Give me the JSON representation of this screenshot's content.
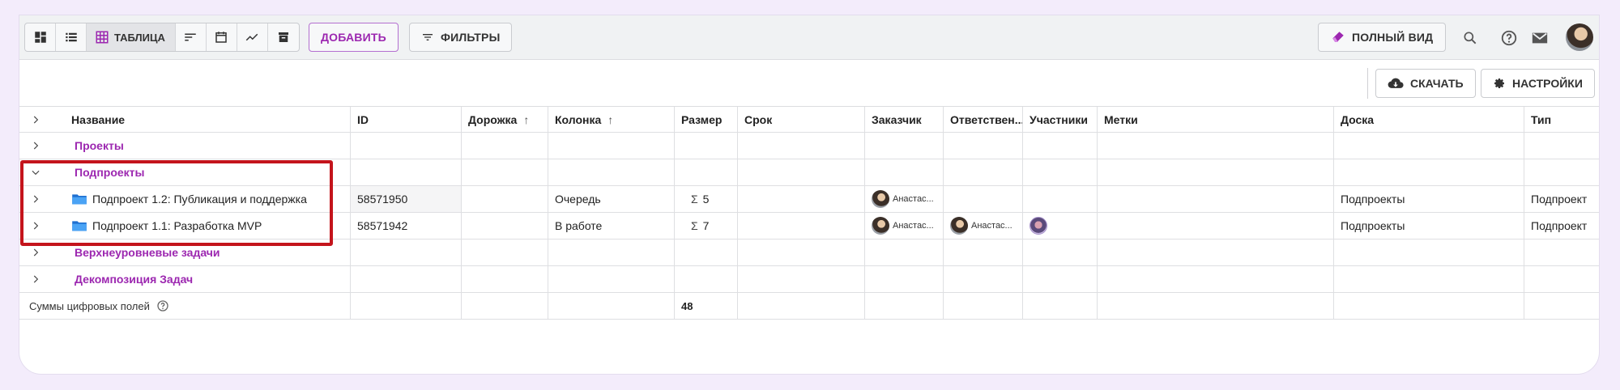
{
  "toolbar": {
    "views": [
      {
        "icon": "dashboard-icon"
      },
      {
        "icon": "list-icon"
      },
      {
        "icon": "grid-table-icon",
        "label": "ТАБЛИЦА",
        "active": true
      },
      {
        "icon": "sort-lines-icon"
      },
      {
        "icon": "calendar-icon"
      },
      {
        "icon": "trend-chart-icon"
      },
      {
        "icon": "archive-icon"
      }
    ],
    "add_label": "ДОБАВИТЬ",
    "filters_label": "ФИЛЬТРЫ",
    "full_view_label": "ПОЛНЫЙ ВИД",
    "accent_color": "#9c27b0"
  },
  "subbar": {
    "download_label": "СКАЧАТЬ",
    "settings_label": "НАСТРОЙКИ"
  },
  "table": {
    "columns": {
      "name": "Название",
      "id": "ID",
      "lane": "Дорожка",
      "column": "Колонка",
      "size": "Размер",
      "due": "Срок",
      "customer": "Заказчик",
      "responsible": "Ответствен...",
      "participants": "Участники",
      "tags": "Метки",
      "board": "Доска",
      "type": "Тип"
    },
    "groups": {
      "projects": "Проекты",
      "subprojects": "Подпроекты",
      "top_tasks": "Верхнеуровневые задачи",
      "decomposition": "Декомпозиция Задач"
    },
    "rows": [
      {
        "name": "Подпроект 1.2: Публикация и поддержка",
        "id": "58571950",
        "column": "Очередь",
        "size": "5",
        "customer": "Анастас...",
        "board": "Подпроекты",
        "type": "Подпроект"
      },
      {
        "name": "Подпроект 1.1: Разработка MVP",
        "id": "58571942",
        "column": "В работе",
        "size": "7",
        "customer": "Анастас...",
        "responsible": "Анастас...",
        "board": "Подпроекты",
        "type": "Подпроект"
      }
    ],
    "sum_label": "Суммы цифровых полей",
    "sum_size": "48",
    "sigma": "Σ"
  }
}
